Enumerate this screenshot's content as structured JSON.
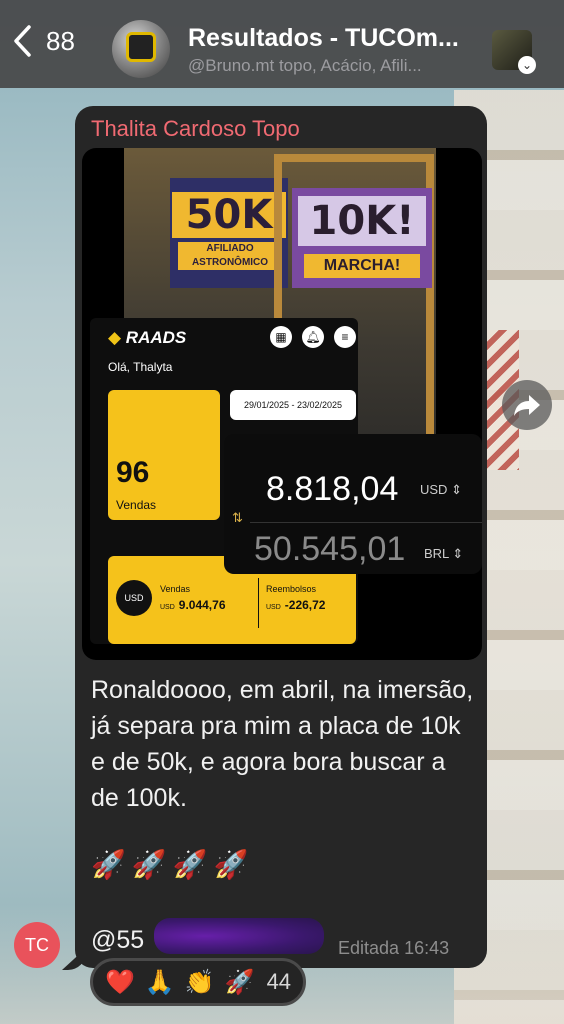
{
  "header": {
    "back_count": "88",
    "title": "Resultados - TUCOm...",
    "subtitle": "@Bruno.mt topo, Acácio, Afili..."
  },
  "message": {
    "sender": "Thalita Cardoso Topo",
    "text": "Ronaldoooo, em abril, na imersão, já separa pra mim a placa de 10k e de 50k, e agora bora buscar a de 100k.",
    "rockets": "🚀🚀🚀🚀",
    "mention": "@55",
    "edited_label": "Editada",
    "time": "16:43",
    "sender_initials": "TC"
  },
  "image": {
    "sign_50k": "50K",
    "sign_50k_sub": "AFILIADO ASTRONÔMICO",
    "sign_10k": "10K!",
    "sign_10k_sub": "MARCHA!",
    "app_logo": "RAADS",
    "greeting": "Olá, Thalyta",
    "sales_count": "96",
    "sales_label": "Vendas",
    "date_range": "29/01/2025 - 23/02/2025",
    "usd_badge": "USD",
    "vendas_label": "Vendas",
    "vendas_value": "9.044,76",
    "reembolsos_label": "Reembolsos",
    "reembolsos_value": "-226,72",
    "currency_prefix": "USD",
    "converter_amount_1": "8.818,04",
    "converter_currency_1": "USD",
    "converter_amount_2": "50.545,01",
    "converter_currency_2": "BRL"
  },
  "reactions": {
    "emojis": [
      "❤️",
      "🙏",
      "👏",
      "🚀"
    ],
    "count": "44"
  },
  "colors": {
    "sender_name": "#f06a72",
    "bubble_bg": "#262626",
    "avatar_bg": "#e9525b",
    "raads_yellow": "#f5c21b"
  }
}
